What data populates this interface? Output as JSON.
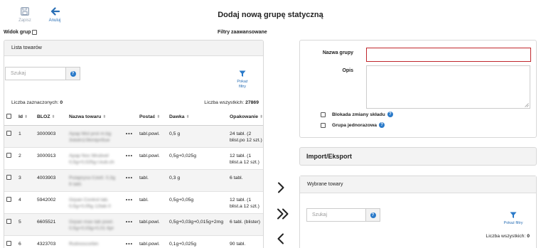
{
  "toolbar": {
    "save_label": "Zapisz",
    "cancel_label": "Anuluj"
  },
  "page": {
    "title": "Dodaj nową grupę statyczną"
  },
  "view_groups_label": "Widok grup",
  "advanced_filters_label": "Filtry zaawansowane",
  "products_panel": {
    "title": "Lista towarów",
    "search_placeholder": "Szukaj",
    "filter_label_1": "Pokaż",
    "filter_label_2": "filtry",
    "selected_label": "Liczba zaznaczonych:",
    "selected_count": "0",
    "total_label": "Liczba wszystkich:",
    "total_count": "27869",
    "columns": {
      "id": "Id",
      "bloz": "BLOZ",
      "name": "Nazwa towaru",
      "form": "Postać",
      "dose": "Dawka",
      "pack": "Opakowanie"
    },
    "rows": [
      {
        "id": "1",
        "bloz": "3000903",
        "name_1": "Apap Mol prot m.bg",
        "name_2": "3sbdn1/3kmipn5ue",
        "form": "tabl.powl.",
        "dose": "0,5 g",
        "pack_1": "24 tabl. (2",
        "pack_2": "blist.po 12 szt.)"
      },
      {
        "id": "2",
        "bloz": "3000913",
        "name_1": "Apap Noc Mrubvel",
        "name_2": "0,5g+0,025g t.kub.ch",
        "form": "tabl.powl.",
        "dose": "0,5g+0,025g",
        "pack_1": "12 tabl. (1",
        "pack_2": "blist.a 12 szt.)"
      },
      {
        "id": "3",
        "bloz": "4003903",
        "name_1": "Pulapryxa 0,kell. 0,3g",
        "name_2": "6 tabl.",
        "form": "tabl.",
        "dose": "0,3 g",
        "pack_1": "6 tabl.",
        "pack_2": ""
      },
      {
        "id": "4",
        "bloz": "5942002",
        "name_1": "Grpan Control tab.",
        "name_2": "0,5g+0,05g 12tab 0",
        "form": "tabl.",
        "dose": "0,5g+0,05g",
        "pack_1": "12 tabl. (1",
        "pack_2": "blist.a 12 szt.)"
      },
      {
        "id": "5",
        "bloz": "6605521",
        "name_1": "Grpan max tab powl.",
        "name_2": "0,5g+0,03g+0,01 6pr",
        "form": "tabl.powl.",
        "dose": "0,5g+0,03g+0,015g+2mg",
        "pack_1": "6 tabl. (blister)",
        "pack_2": ""
      },
      {
        "id": "6",
        "bloz": "4323703",
        "name_1": "Rutinoscorbin",
        "name_2": "",
        "form": "tabl.powl.",
        "dose": "0,1g+0,025g",
        "pack_1": "90 tabl.",
        "pack_2": ""
      }
    ]
  },
  "form": {
    "name_label": "Nazwa grupy",
    "name_value": "",
    "desc_label": "Opis",
    "desc_value": "",
    "lock_label": "Blokada zmiany składu",
    "oneoff_label": "Grupa jednorazowa"
  },
  "import_export_label": "Import/Eksport",
  "selected_panel": {
    "title": "Wybrane towary",
    "search_placeholder": "Szukaj",
    "filter_label": "Pokaż filtry",
    "total_label": "Liczba wszystkich:",
    "total_count": "0"
  },
  "colors": {
    "accent": "#2a7ac9",
    "error_border": "#c0262c"
  }
}
